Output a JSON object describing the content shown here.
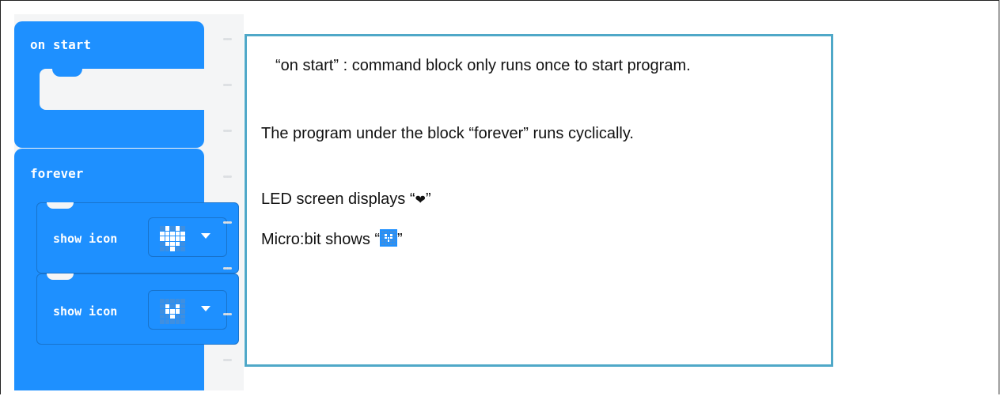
{
  "blocks": {
    "on_start": {
      "label": "on start"
    },
    "forever": {
      "label": "forever",
      "statements": [
        {
          "label": "show icon",
          "icon": "heart-icon",
          "pattern": [
            0,
            1,
            0,
            1,
            0,
            1,
            1,
            1,
            1,
            1,
            1,
            1,
            1,
            1,
            1,
            0,
            1,
            1,
            1,
            0,
            0,
            0,
            1,
            0,
            0
          ]
        },
        {
          "label": "show icon",
          "icon": "small-heart-icon",
          "pattern": [
            0,
            0,
            0,
            0,
            0,
            0,
            1,
            0,
            1,
            0,
            0,
            1,
            1,
            1,
            0,
            0,
            0,
            1,
            0,
            0,
            0,
            0,
            0,
            0,
            0
          ]
        }
      ]
    }
  },
  "explanation": {
    "line1": "“on start” : command block only runs once to start program.",
    "line2": "The program under the block  “forever”  runs cyclically.",
    "line3_prefix": "LED screen displays “",
    "line3_symbol": "❤",
    "line3_suffix": "”",
    "line4_prefix": "Micro:bit shows “",
    "line4_suffix": "”"
  },
  "colors": {
    "block_blue": "#1e90ff",
    "box_border": "#4fa8c8"
  }
}
